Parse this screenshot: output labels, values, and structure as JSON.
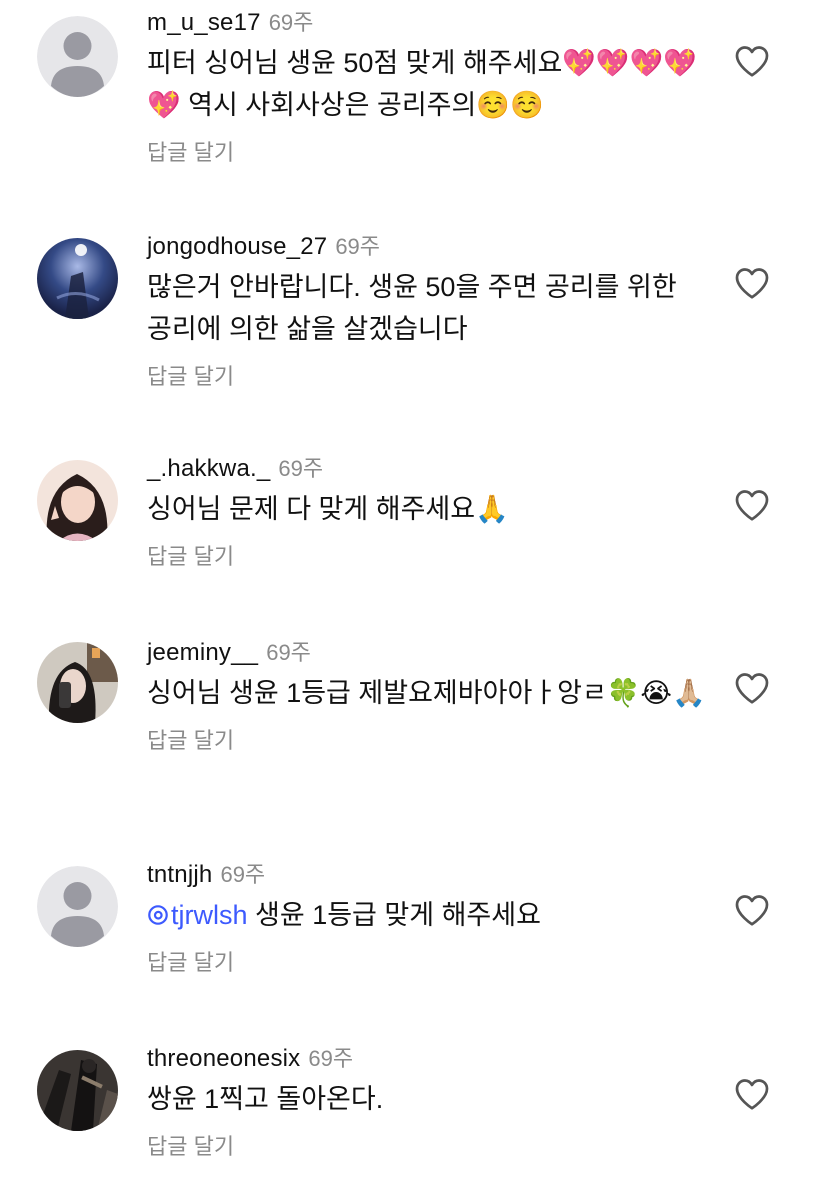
{
  "comments": [
    {
      "username": "m_u_se17",
      "time": "69주",
      "text": "피터 싱어님 생윤 50점 맞게 해주세요💖💖💖💖💖 역시 사회사상은 공리주의☺️☺️",
      "reply_label": "답글 달기",
      "avatar": "default-avatar"
    },
    {
      "username": "jongodhouse_27",
      "time": "69주",
      "text": "많은거 안바랍니다. 생윤 50을 주면 공리를 위한 공리에 의한 삶을 살겠습니다",
      "reply_label": "답글 달기",
      "avatar": "photo-avatar"
    },
    {
      "username": "_.hakkwa._",
      "time": "69주",
      "text": "싱어님 문제 다 맞게 해주세요🙏",
      "reply_label": "답글 달기",
      "avatar": "photo-avatar"
    },
    {
      "username": "jeeminy__",
      "time": "69주",
      "text": "싱어님 생윤 1등급 제발요제바아아ㅏ앙ㄹ🍀😭🙏🏼",
      "reply_label": "답글 달기",
      "avatar": "photo-avatar"
    },
    {
      "username": "tntnjjh",
      "time": "69주",
      "mention": "tjrwlsh",
      "text": " 생윤 1등급 맞게 해주세요",
      "reply_label": "답글 달기",
      "avatar": "default-avatar"
    },
    {
      "username": "threoneonesix",
      "time": "69주",
      "text": "쌍윤 1찍고 돌아온다.",
      "reply_label": "답글 달기",
      "avatar": "photo-avatar"
    }
  ],
  "colors": {
    "mention": "#3d5afe",
    "meta_gray": "#8a8a8a",
    "text": "#111111"
  },
  "icons": {
    "like": "heart-outline-icon",
    "mention": "threads-at-icon"
  }
}
